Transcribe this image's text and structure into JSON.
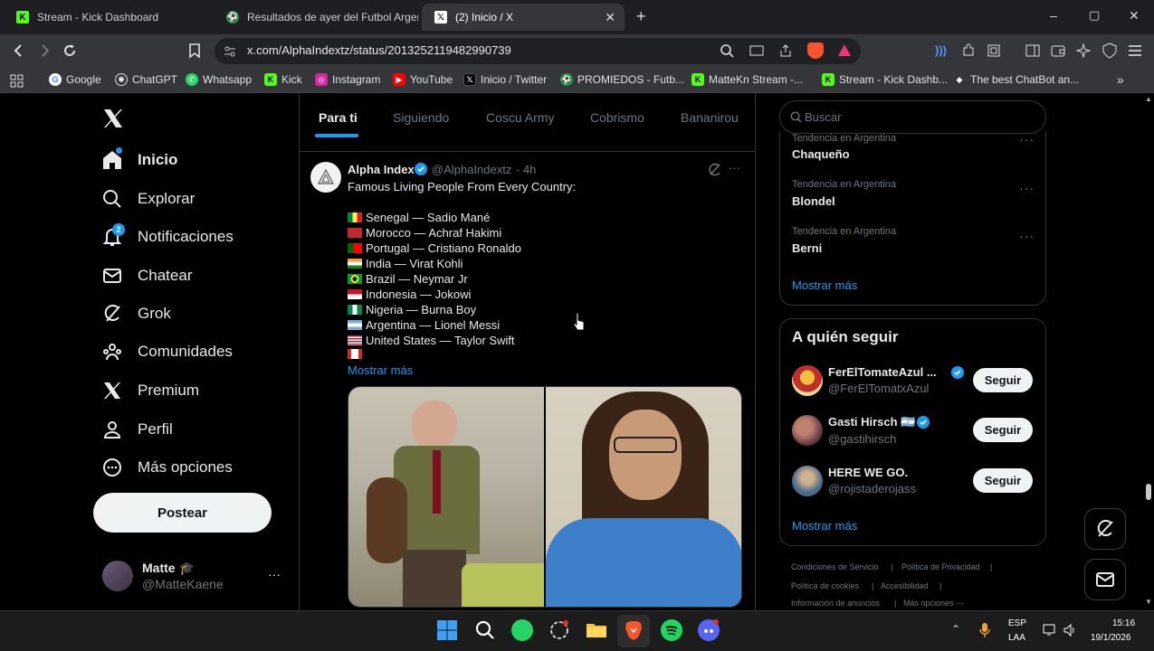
{
  "browser": {
    "tabs": [
      {
        "title": "Stream - Kick Dashboard"
      },
      {
        "title": "Resultados de ayer del Futbol Argent"
      },
      {
        "title": "(2) Inicio / X"
      }
    ],
    "new_tab": "+",
    "url": "x.com/AlphaIndextz/status/2013252119482990739",
    "bookmarks": [
      "Google",
      "ChatGPT",
      "Whatsapp",
      "Kick",
      "Instagram",
      "YouTube",
      "Inicio / Twitter",
      "PROMIEDOS - Futb...",
      "MatteKn Stream -...",
      "Stream - Kick Dashb...",
      "The best ChatBot an..."
    ],
    "window_controls": {
      "minimize": "–",
      "maximize": "▢",
      "close": "✕"
    }
  },
  "nav": {
    "items": [
      {
        "label": "Inicio",
        "icon": "home-icon"
      },
      {
        "label": "Explorar",
        "icon": "search-icon"
      },
      {
        "label": "Notificaciones",
        "icon": "bell-icon",
        "badge": "2"
      },
      {
        "label": "Chatear",
        "icon": "mail-icon"
      },
      {
        "label": "Grok",
        "icon": "grok-icon"
      },
      {
        "label": "Comunidades",
        "icon": "communities-icon"
      },
      {
        "label": "Premium",
        "icon": "x-logo-icon"
      },
      {
        "label": "Perfil",
        "icon": "profile-icon"
      },
      {
        "label": "Más opciones",
        "icon": "more-icon"
      }
    ],
    "post_button": "Postear",
    "account": {
      "name": "Matte",
      "emoji": "🎓",
      "handle": "@MatteKaene",
      "more": "···"
    }
  },
  "feed": {
    "tabs": [
      "Para ti",
      "Siguiendo",
      "Coscu Army",
      "Cobrismo",
      "Bananirou"
    ],
    "tweet": {
      "author": "Alpha Index",
      "handle": "@AlphaIndextz",
      "time": "· 4h",
      "text": "Famous Living People From Every Country:",
      "lines": [
        {
          "flag": "senegal",
          "text": "Senegal — Sadio Mané"
        },
        {
          "flag": "morocco",
          "text": "Morocco — Achraf Hakimi"
        },
        {
          "flag": "portugal",
          "text": "Portugal — Cristiano Ronaldo"
        },
        {
          "flag": "india",
          "text": "India — Virat Kohli"
        },
        {
          "flag": "brazil",
          "text": "Brazil — Neymar Jr"
        },
        {
          "flag": "indonesia",
          "text": "Indonesia — Jokowi"
        },
        {
          "flag": "nigeria",
          "text": "Nigeria — Burna Boy"
        },
        {
          "flag": "argentina",
          "text": "Argentina — Lionel Messi"
        },
        {
          "flag": "usa",
          "text": "United States — Taylor Swift"
        },
        {
          "flag": "canada",
          "text": ""
        }
      ],
      "show_more": "Mostrar más"
    }
  },
  "sidebar": {
    "search_placeholder": "Buscar",
    "trends": [
      {
        "context": "Tendencia en Argentina",
        "name": "Chaqueño"
      },
      {
        "context": "Tendencia en Argentina",
        "name": "Blondel"
      },
      {
        "context": "Tendencia en Argentina",
        "name": "Berni"
      }
    ],
    "trends_show_more": "Mostrar más",
    "who_to_follow_title": "A quién seguir",
    "follow": [
      {
        "name": "FerElTomateAzul ...",
        "handle": "@FerElTomatxAzul",
        "button": "Seguir"
      },
      {
        "name": "Gasti Hirsch 🇦🇷",
        "handle": "@gastihirsch",
        "button": "Seguir"
      },
      {
        "name": "HERE WE GO.",
        "handle": "@rojistaderojass",
        "button": "Seguir"
      }
    ],
    "follow_show_more": "Mostrar más",
    "footer": [
      "Condiciones de Servicio",
      "Política de Privacidad",
      "Política de cookies",
      "Accesibilidad",
      "Información de anuncios",
      "Más opciones ···"
    ]
  },
  "taskbar": {
    "lang": "ESP",
    "lang2": "LAA",
    "time": "15:16",
    "date": "19/1/2026"
  },
  "colors": {
    "accent": "#1d9bf0",
    "background": "#000000",
    "text": "#e7e9ea",
    "muted": "#71767b"
  }
}
